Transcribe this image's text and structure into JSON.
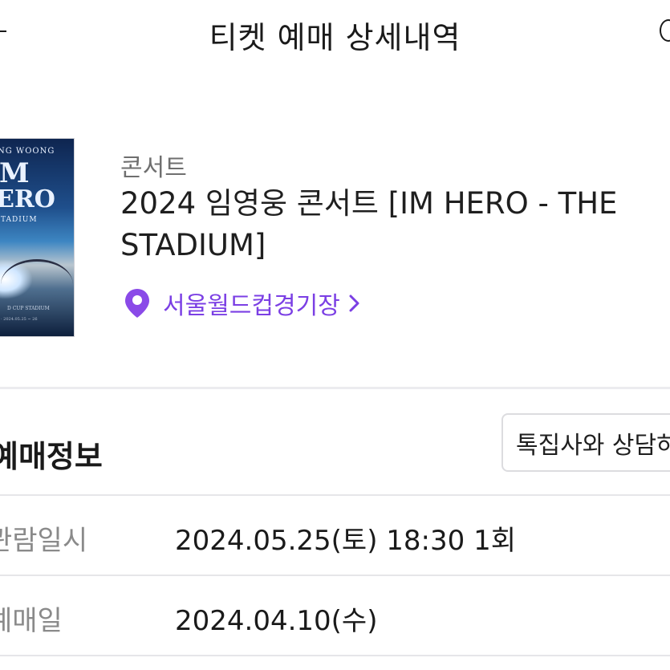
{
  "header": {
    "title": "티켓 예매 상세내역",
    "back_icon": "back-arrow-icon",
    "right_icon": "info-icon"
  },
  "event": {
    "poster": {
      "line1": "NG WOONG",
      "line2": "M",
      "line3": "ERO",
      "line4": "TADIUM",
      "line5": "D CUP STADIUM",
      "line6": "· 2024.05.25 ~ 26"
    },
    "category": "콘서트",
    "title": "2024 임영웅 콘서트 [IM HERO - THE STADIUM]",
    "venue": "서울월드컵경기장",
    "venue_icon": "location-pin-icon",
    "venue_chevron_icon": "chevron-right-icon",
    "accent_color": "#7b3fe4"
  },
  "section": {
    "title": "예매정보",
    "consult_button": "톡집사와 상담하기"
  },
  "rows": [
    {
      "label": "관람일시",
      "value": "2024.05.25(토) 18:30 1회"
    },
    {
      "label": "예매일",
      "value": "2024.04.10(수)"
    }
  ]
}
